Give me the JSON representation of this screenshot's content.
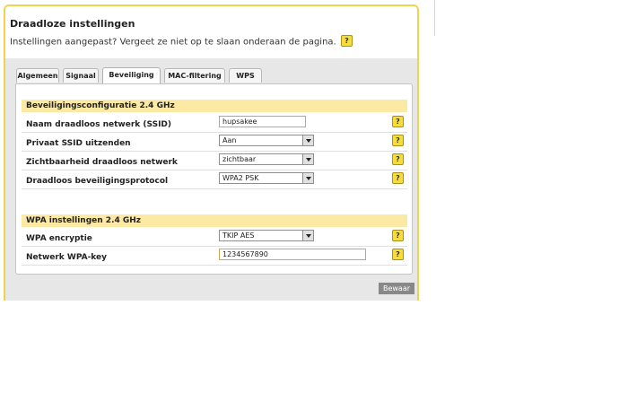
{
  "header": {
    "title": "Draadloze instellingen",
    "subtitle": "Instellingen aangepast? Vergeet ze niet op te slaan onderaan de pagina.",
    "help": "?"
  },
  "tabs": [
    {
      "label": "Algemeen",
      "active": false
    },
    {
      "label": "Signaal",
      "active": false
    },
    {
      "label": "Beveiliging",
      "active": true
    },
    {
      "label": "MAC-filtering",
      "active": false
    },
    {
      "label": "WPS",
      "active": false
    }
  ],
  "security_section": {
    "title": "Beveiligingsconfiguratie 2.4 GHz",
    "rows": [
      {
        "label": "Naam draadloos netwerk (SSID)",
        "type": "text",
        "value": "hupsakee"
      },
      {
        "label": "Privaat SSID uitzenden",
        "type": "select",
        "value": "Aan"
      },
      {
        "label": "Zichtbaarheid draadloos netwerk",
        "type": "select",
        "value": "zichtbaar"
      },
      {
        "label": "Draadloos beveiligingsprotocol",
        "type": "select",
        "value": "WPA2 PSK"
      }
    ]
  },
  "wpa_section": {
    "title": "WPA instellingen 2.4 GHz",
    "rows": [
      {
        "label": "WPA encryptie",
        "type": "select",
        "value": "TKIP AES"
      },
      {
        "label": "Netwerk WPA-key",
        "type": "text",
        "value": "1234567890"
      }
    ]
  },
  "save_label": "Bewaar",
  "colors": {
    "panel_border": "#f2d24a",
    "section_header": "#fbe9a4",
    "help_icon": "#f7dd3c",
    "grey_background": "#e7e7e7"
  }
}
